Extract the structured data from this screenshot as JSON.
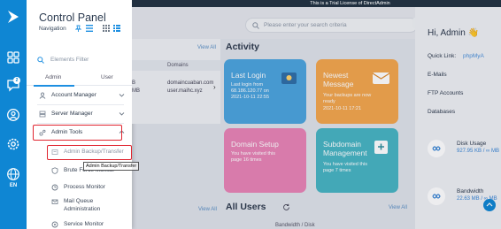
{
  "rail": {
    "icons": [
      "directadmin-logo",
      "dashboard-icon",
      "messages-icon",
      "user-icon",
      "settings-icon",
      "globe-icon"
    ],
    "message_badge": "2",
    "language": "EN",
    "color": "#0f86d3"
  },
  "sidebar": {
    "title": "Control Panel",
    "nav_label": "Navigation",
    "filter_placeholder": "Elements Filter",
    "tabs": [
      "Admin",
      "User"
    ],
    "menu": [
      {
        "label": "Account Manager",
        "icon": "account-icon"
      },
      {
        "label": "Server Manager",
        "icon": "server-icon"
      },
      {
        "label": "Admin Tools",
        "icon": "tools-icon"
      }
    ],
    "submenu": [
      {
        "label": "Admin Backup/Transfer",
        "icon": "backup-icon"
      },
      {
        "label": "Brute Force Monitor",
        "icon": "shield-icon"
      },
      {
        "label": "Process Monitor",
        "icon": "process-icon"
      },
      {
        "label": "Mail Queue Administration",
        "icon": "mail-icon"
      },
      {
        "label": "Service Monitor",
        "icon": "service-icon"
      }
    ],
    "tooltip": "Admin Backup/Transfer"
  },
  "main": {
    "trial_banner": "This is a Trial License of DirectAdmin",
    "search_placeholder": "Please enter your search criteria",
    "left_card": {
      "view_all": "View All",
      "domains_header": "Domains",
      "rows": [
        {
          "size": "B",
          "domain": "domaincuaban.com"
        },
        {
          "size": "MB",
          "domain": "user.maihc.xyz"
        }
      ]
    },
    "activity": {
      "title": "Activity",
      "tiles": [
        {
          "title": "Last Login",
          "subtitle": "Last login from 68.186.120.77 on 2021-10-11 22:55",
          "color": "#4ba4de"
        },
        {
          "title": "Newest Message",
          "subtitle": "Your backups are now ready",
          "subtitle2": "2021-10-11 17:21",
          "color": "#f3a74d"
        },
        {
          "title": "Domain Setup",
          "subtitle": "You have visited this page 16 times",
          "color": "#e984b6"
        },
        {
          "title": "Subdomain Management",
          "subtitle": "You have visited this page 7 times",
          "color": "#47b5c3"
        }
      ]
    },
    "users": {
      "title": "All Users",
      "view_all": "View All",
      "column": "Bandwidth / Disk"
    },
    "view_all_mid": "View All",
    "right": {
      "greeting": "Hi, Admin 👋",
      "quick_link_label": "Quick Link:",
      "quick_link_value": "phpMyA",
      "email_label": "E-Mails",
      "ftp_label": "FTP Accounts",
      "db_label": "Databases",
      "disk_usage_label": "Disk Usage",
      "disk_usage_value": "927.95 KB / ∞ MB",
      "bandwidth_label": "Bandwidth",
      "bandwidth_value": "22.63 MB / ∞ MB"
    }
  }
}
